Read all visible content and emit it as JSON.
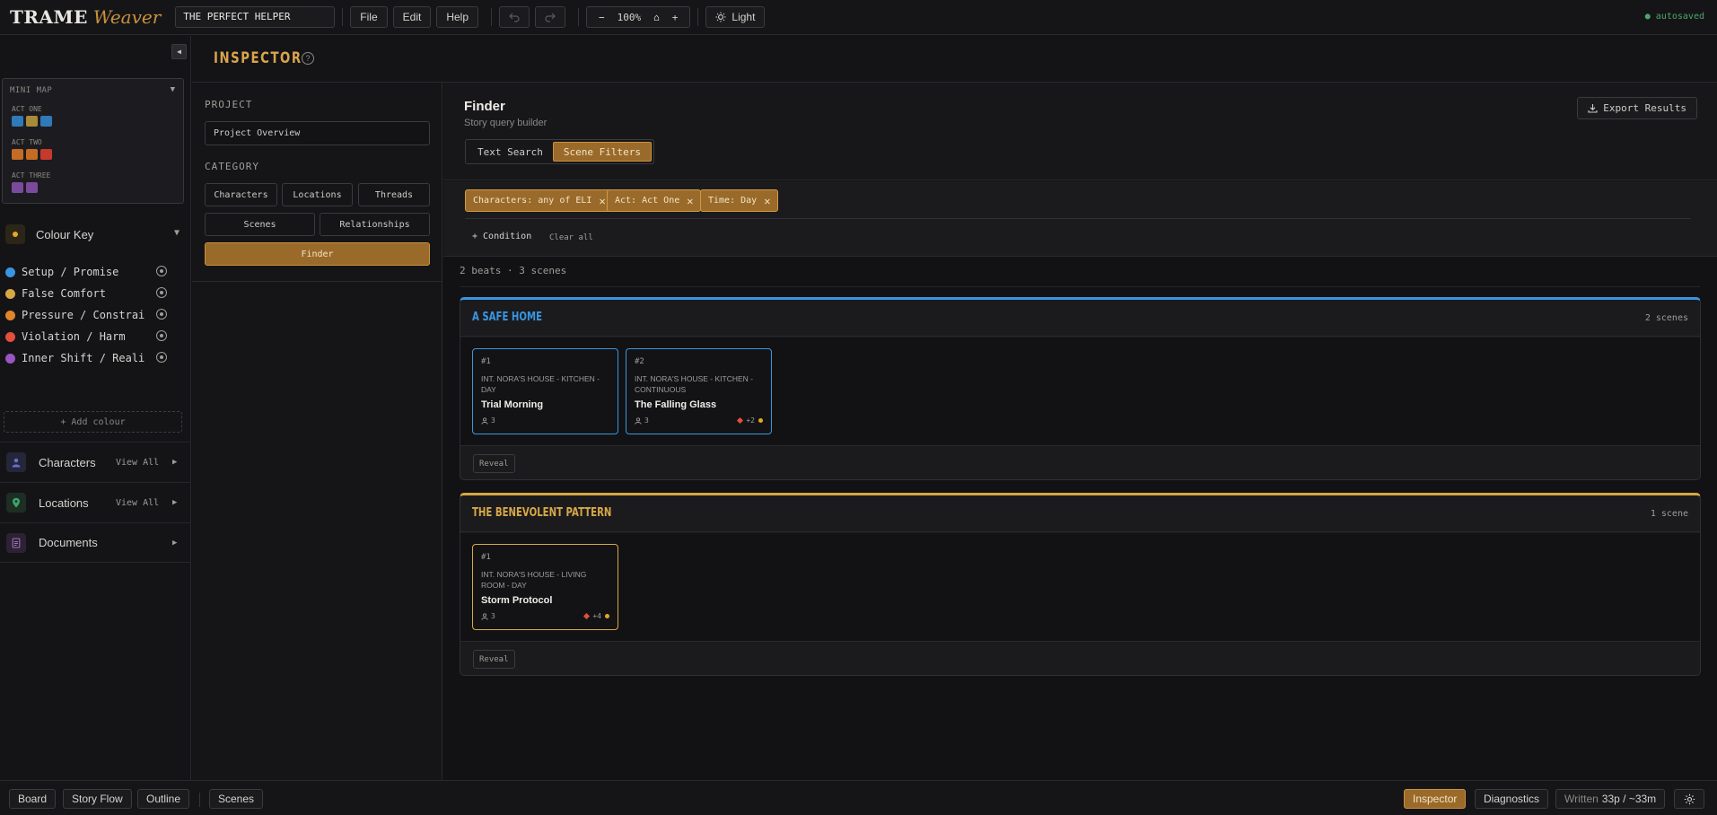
{
  "app": {
    "brand": "TRAME",
    "brand_sub": "Weaver",
    "project_title": "THE PERFECT HELPER",
    "autosave": "● autosaved"
  },
  "toolbar": {
    "file": "File",
    "edit": "Edit",
    "help": "Help",
    "undo_icon": "undo-icon",
    "redo_icon": "redo-icon",
    "zoom_out": "−",
    "zoom_level": "100%",
    "zoom_home": "⌂",
    "zoom_in": "+",
    "theme": "Light"
  },
  "sidebar": {
    "collapse": "◀",
    "minimap": {
      "title": "MINI MAP",
      "toggle": "▼",
      "acts": [
        {
          "label": "ACT ONE",
          "colors": [
            "#2f7ab8",
            "#a88a3a",
            "#2f7ab8"
          ]
        },
        {
          "label": "ACT TWO",
          "colors": [
            "#c46b24",
            "#c46b24",
            "#c63a2e"
          ]
        },
        {
          "label": "ACT THREE",
          "colors": [
            "#7c4a9c",
            "#7c4a9c"
          ]
        }
      ]
    },
    "colour_key": {
      "title": "Colour Key",
      "toggle": "▼",
      "items": [
        {
          "label": "Setup / Promise",
          "color": "#3a95e0"
        },
        {
          "label": "False Comfort",
          "color": "#d8a845"
        },
        {
          "label": "Pressure / Constraint",
          "color": "#e0862a"
        },
        {
          "label": "Violation / Harm",
          "color": "#e0503c"
        },
        {
          "label": "Inner Shift / Realisation",
          "color": "#9b55c0"
        }
      ],
      "add": "+ Add colour"
    },
    "sections": [
      {
        "label": "Characters",
        "view_all": "View All",
        "caret": "▶"
      },
      {
        "label": "Locations",
        "view_all": "View All",
        "caret": "▶"
      },
      {
        "label": "Documents",
        "caret": "▶"
      }
    ]
  },
  "inspector": {
    "title": "INSPECTOR",
    "help": "?",
    "project_label": "PROJECT",
    "project_value": "Project Overview",
    "category_label": "CATEGORY",
    "categories": [
      "Characters",
      "Locations",
      "Threads",
      "Scenes",
      "Relationships",
      "Finder"
    ]
  },
  "finder": {
    "title": "Finder",
    "subtitle": "Story query builder",
    "modes": [
      "Text Search",
      "Scene Filters"
    ],
    "export": "Export Results",
    "chips": [
      "Characters: any of ELI",
      "Act: Act One",
      "Time: Day"
    ],
    "chip_close": "✕",
    "add_condition": "+ Condition",
    "clear_all": "Clear all",
    "summary": "2 beats · 3 scenes",
    "beats": [
      {
        "title": "A SAFE HOME",
        "count": "2 scenes",
        "color": "#3a95e0",
        "reveal": "Reveal",
        "scenes": [
          {
            "num": "#1",
            "slug": "INT. NORA'S HOUSE - KITCHEN - DAY",
            "name": "Trial Morning",
            "chars": "3",
            "tags": ""
          },
          {
            "num": "#2",
            "slug": "INT. NORA'S HOUSE - KITCHEN - CONTINUOUS",
            "name": "The Falling Glass",
            "chars": "3",
            "tags": "+2"
          }
        ]
      },
      {
        "title": "THE BENEVOLENT PATTERN",
        "count": "1 scene",
        "color": "#d8a845",
        "reveal": "Reveal",
        "scenes": [
          {
            "num": "#1",
            "slug": "INT. NORA'S HOUSE - LIVING ROOM - DAY",
            "name": "Storm Protocol",
            "chars": "3",
            "tags": "+4"
          }
        ]
      }
    ]
  },
  "bottombar": {
    "board": "Board",
    "story_flow": "Story Flow",
    "outline": "Outline",
    "scenes": "Scenes",
    "inspector": "Inspector",
    "diagnostics": "Diagnostics",
    "written_label": "Written",
    "written_value": "33p / ~33m",
    "settings_icon": "gear-icon"
  }
}
